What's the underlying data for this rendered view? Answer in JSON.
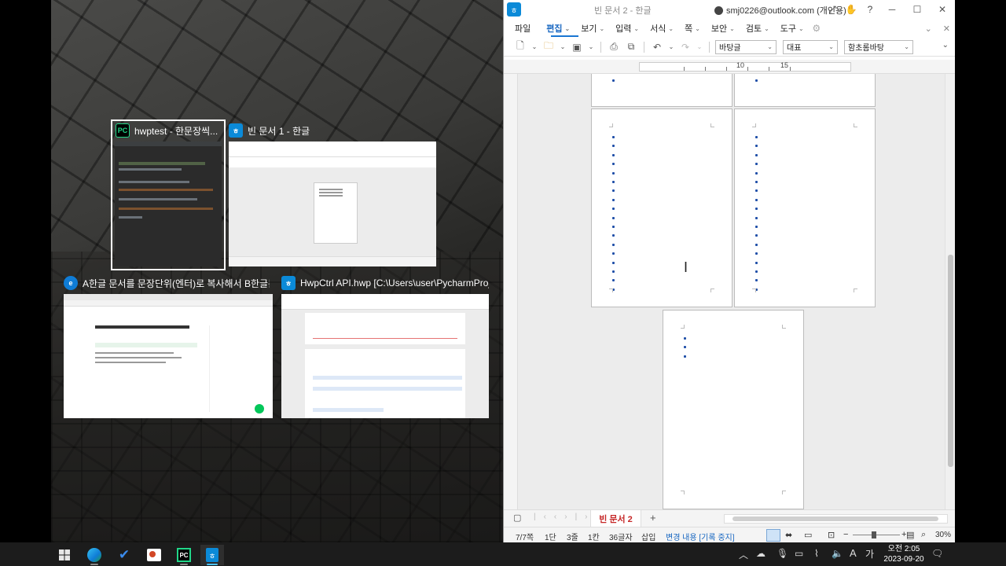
{
  "snap_assist": {
    "items": [
      {
        "title": "hwptest - 한문장씩...",
        "icon": "pycharm-icon"
      },
      {
        "title": "빈 문서 1 - 한글",
        "icon": "hangul-icon"
      },
      {
        "title": "A한글 문서를 문장단위(엔터)로 복사해서 B한글문서에...",
        "icon": "edge-icon"
      },
      {
        "title": "HwpCtrl API.hwp [C:\\Users\\user\\PycharmProjects\\hwp...",
        "icon": "hangul-icon"
      }
    ]
  },
  "hwp": {
    "doc_title": "빈 문서 2 - 한글",
    "account": "smj0226@outlook.com (개인용)",
    "menu": [
      "파일",
      "편집",
      "보기",
      "입력",
      "서식",
      "쪽",
      "보안",
      "검토",
      "도구"
    ],
    "active_menu": "편집",
    "toolbar": {
      "style_select": "바탕글",
      "lang_select": "대표",
      "font_select": "함초롬바탕"
    },
    "ruler_labels": [
      "10",
      "15"
    ],
    "tab": {
      "label": "빈 문서 2",
      "add": "+"
    },
    "status": {
      "page": "7/7쪽",
      "column": "1단",
      "line": "3줄",
      "cell": "1칸",
      "chars": "36글자",
      "mode": "삽입",
      "tracking": "변경 내용 [기록 중지]",
      "zoom": "30%"
    }
  },
  "taskbar": {
    "apps": [
      "start-icon",
      "edge-icon",
      "todo-icon",
      "powerpoint-icon",
      "pycharm-icon",
      "hangul-icon"
    ],
    "time": "오전 2:05",
    "date": "2023-09-20",
    "ime_a": "A",
    "ime_ko": "가"
  },
  "colors": {
    "accent": "#1976d2",
    "tab_text": "#c62828",
    "pycharm_green": "#21d789",
    "hwp_blue": "#0b8ad8",
    "edge_blue": "#0f7cd6"
  }
}
